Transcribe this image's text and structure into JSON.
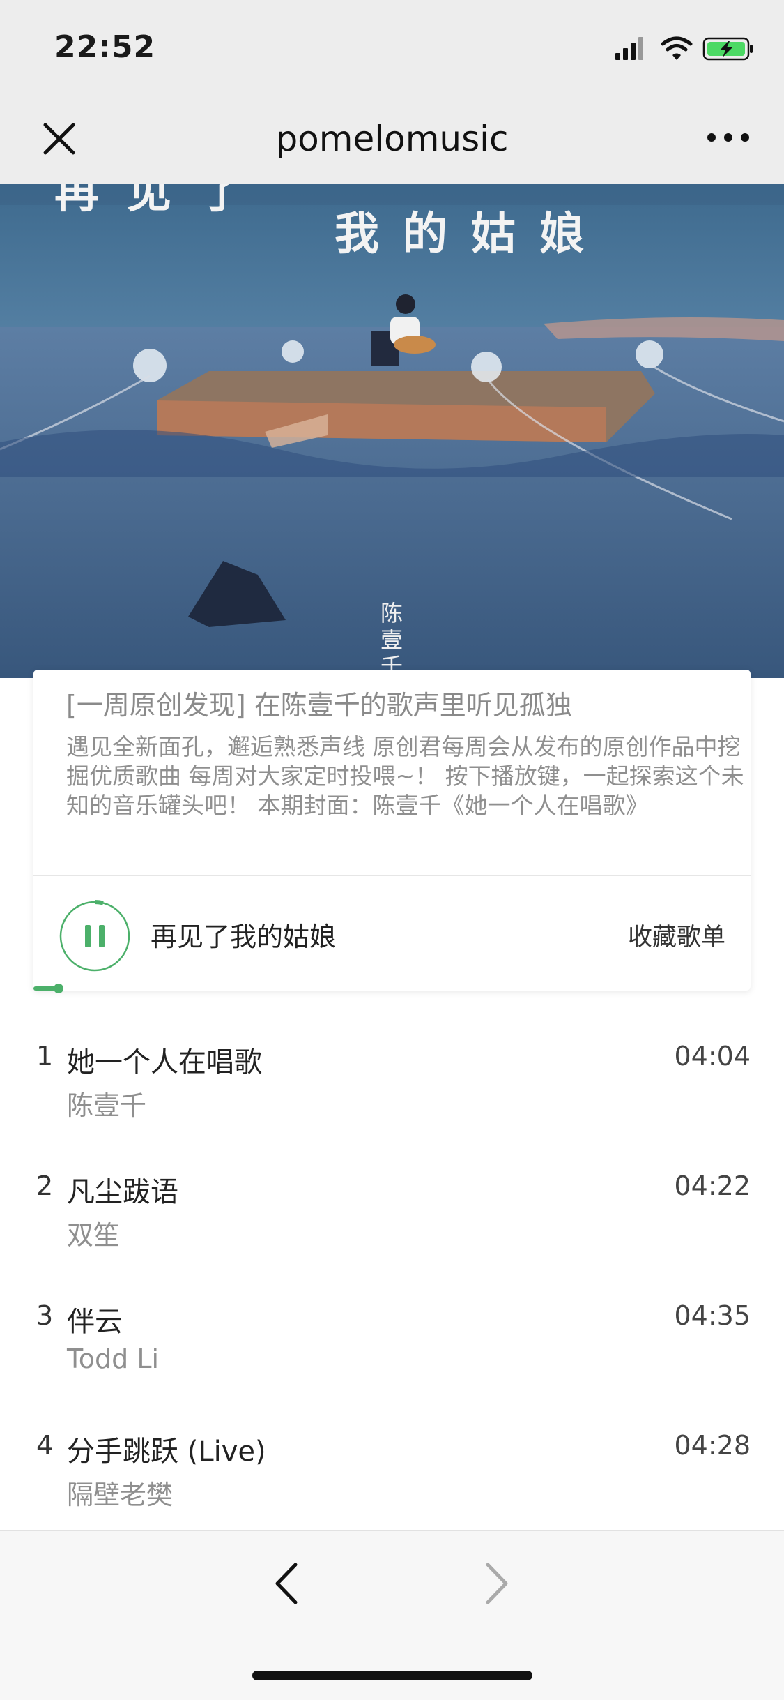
{
  "status_bar": {
    "time": "22:52"
  },
  "nav": {
    "title": "pomelomusic"
  },
  "cover": {
    "title_text": "我的姑娘",
    "partial_title_text": "再见了",
    "artist_text": "陈壹千"
  },
  "info": {
    "title": "[一周原创发现] 在陈壹千的歌声里听见孤独",
    "description": "遇见全新面孔，邂逅熟悉声线 原创君每周会从发布的原创作品中挖掘优质歌曲 每周对大家定时投喂~！ 按下播放键，一起探索这个未知的音乐罐头吧！ 本期封面：陈壹千《她一个人在唱歌》",
    "now_playing": "再见了我的姑娘",
    "save_label": "收藏歌单",
    "progress": 0.035
  },
  "tracks": [
    {
      "num": "1",
      "title": "她一个人在唱歌",
      "artist": "陈壹千",
      "duration": "04:04"
    },
    {
      "num": "2",
      "title": "凡尘跋语",
      "artist": "双笙",
      "duration": "04:22"
    },
    {
      "num": "3",
      "title": "伴云",
      "artist": "Todd Li",
      "duration": "04:35"
    },
    {
      "num": "4",
      "title": "分手跳跃 (Live)",
      "artist": "隔壁老樊",
      "duration": "04:28"
    }
  ],
  "colors": {
    "accent": "#4cb06a",
    "nav_background": "#ededed",
    "cover_sky": "#3f6587"
  },
  "icons": [
    "signal-icon",
    "wifi-icon",
    "battery-charging-icon",
    "close-icon",
    "more-icon",
    "pause-icon",
    "back-arrow-icon",
    "forward-arrow-icon"
  ]
}
